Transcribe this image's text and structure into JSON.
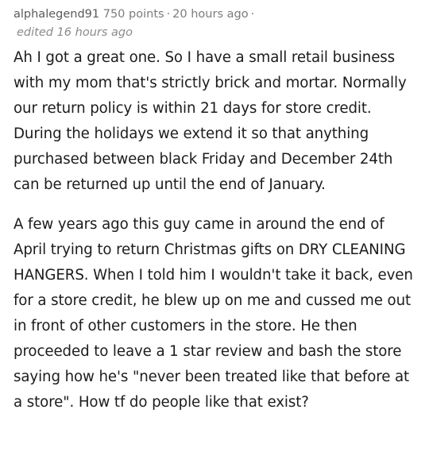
{
  "comment": {
    "author": "alphalegend91",
    "points": "750 points",
    "separator": "·",
    "time": "20 hours ago",
    "separator_end": "·",
    "edited": "edited 16 hours ago",
    "paragraphs": [
      "Ah I got a great one. So I have a small retail business with my mom that's strictly brick and mortar. Normally our return policy is within 21 days for store credit. During the holidays we extend it so that anything purchased between black Friday and December 24th can be returned up until the end of January.",
      "A few years ago this guy came in around the end of April trying to return Christmas gifts on DRY CLEANING HANGERS. When I told him I wouldn't take it back, even for a store credit, he blew up on me and cussed me out in front of other customers in the store. He then proceeded to leave a 1 star review and bash the store saying how he's \"never been treated like that before at a store\". How tf do people like that exist?"
    ]
  }
}
